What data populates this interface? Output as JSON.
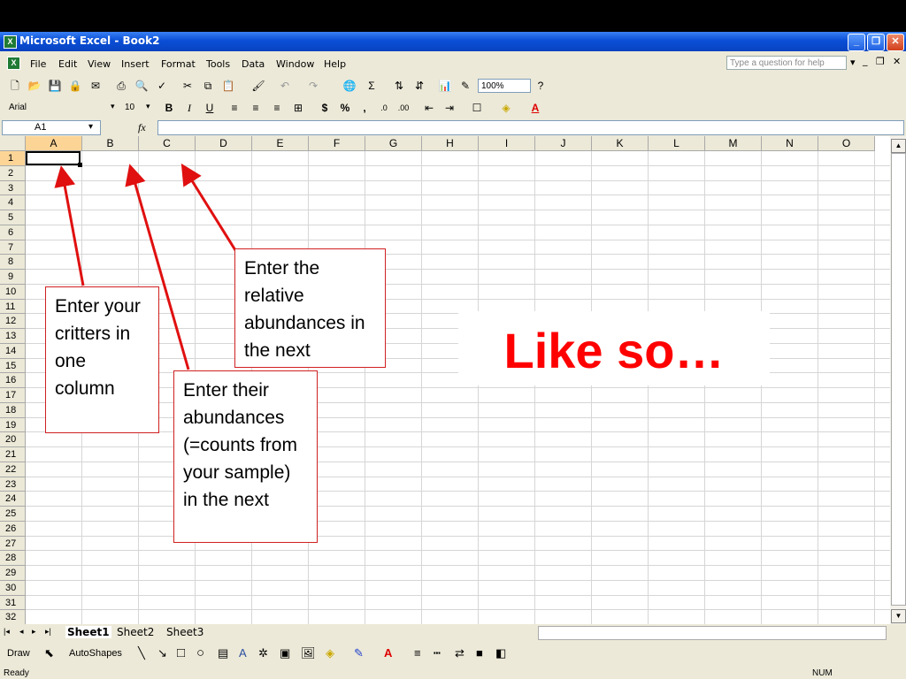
{
  "window": {
    "title": "Microsoft Excel - Book2",
    "icon": "excel-app-icon"
  },
  "menubar": {
    "items": [
      "File",
      "Edit",
      "View",
      "Insert",
      "Format",
      "Tools",
      "Data",
      "Window",
      "Help"
    ],
    "help_placeholder": "Type a question for help"
  },
  "standard_toolbar": {
    "zoom": "100%"
  },
  "formatting_toolbar": {
    "font": "Arial",
    "size": "10",
    "bold": "B",
    "italic": "I",
    "underline": "U",
    "currency": "$",
    "percent": "%",
    "comma": ","
  },
  "formula_bar": {
    "name_box": "A1",
    "fx": "fx",
    "value": ""
  },
  "grid": {
    "columns": [
      "A",
      "B",
      "C",
      "D",
      "E",
      "F",
      "G",
      "H",
      "I",
      "J",
      "K",
      "L",
      "M",
      "N",
      "O"
    ],
    "rows": [
      "1",
      "2",
      "3",
      "4",
      "5",
      "6",
      "7",
      "8",
      "9",
      "10",
      "11",
      "12",
      "13",
      "14",
      "15",
      "16",
      "17",
      "18",
      "19",
      "20",
      "21",
      "22",
      "23",
      "24",
      "25",
      "26",
      "27",
      "28",
      "29",
      "30",
      "31",
      "32"
    ],
    "selected_cell": "A1"
  },
  "sheet_tabs": [
    "Sheet1",
    "Sheet2",
    "Sheet3"
  ],
  "drawing_toolbar": {
    "draw": "Draw",
    "autoshapes": "AutoShapes"
  },
  "statusbar": {
    "left": "Ready",
    "right": "NUM"
  },
  "annotations": {
    "critters": "Enter your critters in one column",
    "abundances": "Enter their abundances (=counts from your sample) in the next",
    "relative": "Enter the relative abundances in the next",
    "like_so": "Like so…"
  },
  "colors": {
    "arrow": "#e01010",
    "callout_border": "#d02020",
    "like_so": "#ff0000"
  }
}
